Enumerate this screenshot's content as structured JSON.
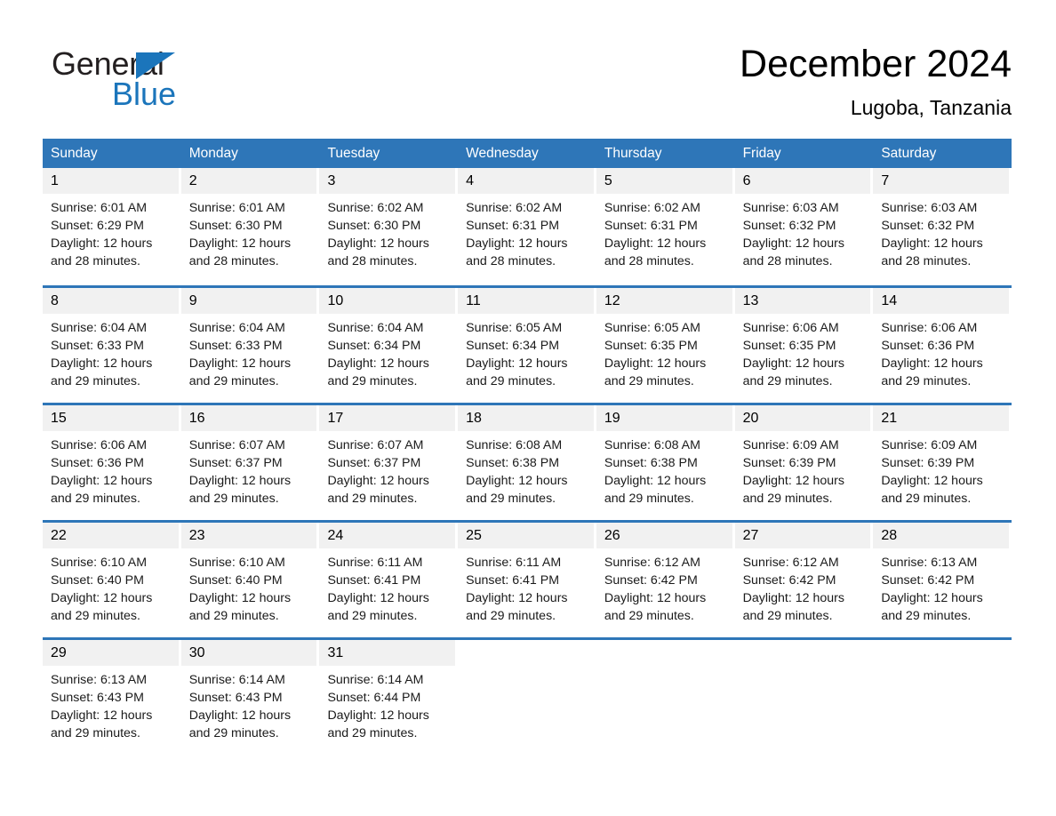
{
  "brand": {
    "name_part1": "General",
    "name_part2": "Blue",
    "accent_color": "#1b75bb",
    "triangle_icon": "triangle-icon"
  },
  "header": {
    "month_title": "December 2024",
    "location": "Lugoba, Tanzania"
  },
  "theme": {
    "header_blue": "#2e76b8",
    "day_band_gray": "#f1f1f1",
    "text_black": "#000000"
  },
  "weekdays": [
    "Sunday",
    "Monday",
    "Tuesday",
    "Wednesday",
    "Thursday",
    "Friday",
    "Saturday"
  ],
  "weeks": [
    [
      {
        "day": "1",
        "sunrise": "Sunrise: 6:01 AM",
        "sunset": "Sunset: 6:29 PM",
        "daylight_line1": "Daylight: 12 hours",
        "daylight_line2": "and 28 minutes."
      },
      {
        "day": "2",
        "sunrise": "Sunrise: 6:01 AM",
        "sunset": "Sunset: 6:30 PM",
        "daylight_line1": "Daylight: 12 hours",
        "daylight_line2": "and 28 minutes."
      },
      {
        "day": "3",
        "sunrise": "Sunrise: 6:02 AM",
        "sunset": "Sunset: 6:30 PM",
        "daylight_line1": "Daylight: 12 hours",
        "daylight_line2": "and 28 minutes."
      },
      {
        "day": "4",
        "sunrise": "Sunrise: 6:02 AM",
        "sunset": "Sunset: 6:31 PM",
        "daylight_line1": "Daylight: 12 hours",
        "daylight_line2": "and 28 minutes."
      },
      {
        "day": "5",
        "sunrise": "Sunrise: 6:02 AM",
        "sunset": "Sunset: 6:31 PM",
        "daylight_line1": "Daylight: 12 hours",
        "daylight_line2": "and 28 minutes."
      },
      {
        "day": "6",
        "sunrise": "Sunrise: 6:03 AM",
        "sunset": "Sunset: 6:32 PM",
        "daylight_line1": "Daylight: 12 hours",
        "daylight_line2": "and 28 minutes."
      },
      {
        "day": "7",
        "sunrise": "Sunrise: 6:03 AM",
        "sunset": "Sunset: 6:32 PM",
        "daylight_line1": "Daylight: 12 hours",
        "daylight_line2": "and 28 minutes."
      }
    ],
    [
      {
        "day": "8",
        "sunrise": "Sunrise: 6:04 AM",
        "sunset": "Sunset: 6:33 PM",
        "daylight_line1": "Daylight: 12 hours",
        "daylight_line2": "and 29 minutes."
      },
      {
        "day": "9",
        "sunrise": "Sunrise: 6:04 AM",
        "sunset": "Sunset: 6:33 PM",
        "daylight_line1": "Daylight: 12 hours",
        "daylight_line2": "and 29 minutes."
      },
      {
        "day": "10",
        "sunrise": "Sunrise: 6:04 AM",
        "sunset": "Sunset: 6:34 PM",
        "daylight_line1": "Daylight: 12 hours",
        "daylight_line2": "and 29 minutes."
      },
      {
        "day": "11",
        "sunrise": "Sunrise: 6:05 AM",
        "sunset": "Sunset: 6:34 PM",
        "daylight_line1": "Daylight: 12 hours",
        "daylight_line2": "and 29 minutes."
      },
      {
        "day": "12",
        "sunrise": "Sunrise: 6:05 AM",
        "sunset": "Sunset: 6:35 PM",
        "daylight_line1": "Daylight: 12 hours",
        "daylight_line2": "and 29 minutes."
      },
      {
        "day": "13",
        "sunrise": "Sunrise: 6:06 AM",
        "sunset": "Sunset: 6:35 PM",
        "daylight_line1": "Daylight: 12 hours",
        "daylight_line2": "and 29 minutes."
      },
      {
        "day": "14",
        "sunrise": "Sunrise: 6:06 AM",
        "sunset": "Sunset: 6:36 PM",
        "daylight_line1": "Daylight: 12 hours",
        "daylight_line2": "and 29 minutes."
      }
    ],
    [
      {
        "day": "15",
        "sunrise": "Sunrise: 6:06 AM",
        "sunset": "Sunset: 6:36 PM",
        "daylight_line1": "Daylight: 12 hours",
        "daylight_line2": "and 29 minutes."
      },
      {
        "day": "16",
        "sunrise": "Sunrise: 6:07 AM",
        "sunset": "Sunset: 6:37 PM",
        "daylight_line1": "Daylight: 12 hours",
        "daylight_line2": "and 29 minutes."
      },
      {
        "day": "17",
        "sunrise": "Sunrise: 6:07 AM",
        "sunset": "Sunset: 6:37 PM",
        "daylight_line1": "Daylight: 12 hours",
        "daylight_line2": "and 29 minutes."
      },
      {
        "day": "18",
        "sunrise": "Sunrise: 6:08 AM",
        "sunset": "Sunset: 6:38 PM",
        "daylight_line1": "Daylight: 12 hours",
        "daylight_line2": "and 29 minutes."
      },
      {
        "day": "19",
        "sunrise": "Sunrise: 6:08 AM",
        "sunset": "Sunset: 6:38 PM",
        "daylight_line1": "Daylight: 12 hours",
        "daylight_line2": "and 29 minutes."
      },
      {
        "day": "20",
        "sunrise": "Sunrise: 6:09 AM",
        "sunset": "Sunset: 6:39 PM",
        "daylight_line1": "Daylight: 12 hours",
        "daylight_line2": "and 29 minutes."
      },
      {
        "day": "21",
        "sunrise": "Sunrise: 6:09 AM",
        "sunset": "Sunset: 6:39 PM",
        "daylight_line1": "Daylight: 12 hours",
        "daylight_line2": "and 29 minutes."
      }
    ],
    [
      {
        "day": "22",
        "sunrise": "Sunrise: 6:10 AM",
        "sunset": "Sunset: 6:40 PM",
        "daylight_line1": "Daylight: 12 hours",
        "daylight_line2": "and 29 minutes."
      },
      {
        "day": "23",
        "sunrise": "Sunrise: 6:10 AM",
        "sunset": "Sunset: 6:40 PM",
        "daylight_line1": "Daylight: 12 hours",
        "daylight_line2": "and 29 minutes."
      },
      {
        "day": "24",
        "sunrise": "Sunrise: 6:11 AM",
        "sunset": "Sunset: 6:41 PM",
        "daylight_line1": "Daylight: 12 hours",
        "daylight_line2": "and 29 minutes."
      },
      {
        "day": "25",
        "sunrise": "Sunrise: 6:11 AM",
        "sunset": "Sunset: 6:41 PM",
        "daylight_line1": "Daylight: 12 hours",
        "daylight_line2": "and 29 minutes."
      },
      {
        "day": "26",
        "sunrise": "Sunrise: 6:12 AM",
        "sunset": "Sunset: 6:42 PM",
        "daylight_line1": "Daylight: 12 hours",
        "daylight_line2": "and 29 minutes."
      },
      {
        "day": "27",
        "sunrise": "Sunrise: 6:12 AM",
        "sunset": "Sunset: 6:42 PM",
        "daylight_line1": "Daylight: 12 hours",
        "daylight_line2": "and 29 minutes."
      },
      {
        "day": "28",
        "sunrise": "Sunrise: 6:13 AM",
        "sunset": "Sunset: 6:42 PM",
        "daylight_line1": "Daylight: 12 hours",
        "daylight_line2": "and 29 minutes."
      }
    ],
    [
      {
        "day": "29",
        "sunrise": "Sunrise: 6:13 AM",
        "sunset": "Sunset: 6:43 PM",
        "daylight_line1": "Daylight: 12 hours",
        "daylight_line2": "and 29 minutes."
      },
      {
        "day": "30",
        "sunrise": "Sunrise: 6:14 AM",
        "sunset": "Sunset: 6:43 PM",
        "daylight_line1": "Daylight: 12 hours",
        "daylight_line2": "and 29 minutes."
      },
      {
        "day": "31",
        "sunrise": "Sunrise: 6:14 AM",
        "sunset": "Sunset: 6:44 PM",
        "daylight_line1": "Daylight: 12 hours",
        "daylight_line2": "and 29 minutes."
      },
      {
        "day": "",
        "sunrise": "",
        "sunset": "",
        "daylight_line1": "",
        "daylight_line2": ""
      },
      {
        "day": "",
        "sunrise": "",
        "sunset": "",
        "daylight_line1": "",
        "daylight_line2": ""
      },
      {
        "day": "",
        "sunrise": "",
        "sunset": "",
        "daylight_line1": "",
        "daylight_line2": ""
      },
      {
        "day": "",
        "sunrise": "",
        "sunset": "",
        "daylight_line1": "",
        "daylight_line2": ""
      }
    ]
  ]
}
